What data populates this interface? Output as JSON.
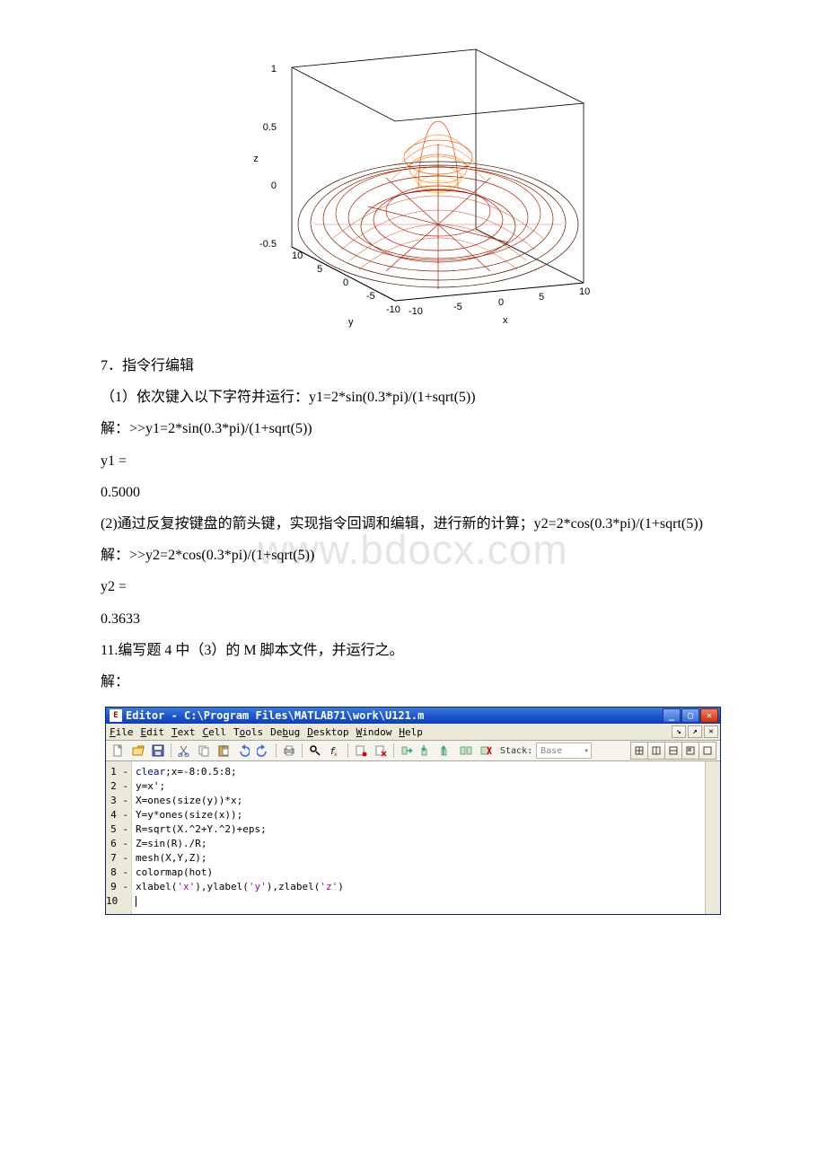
{
  "chart_data": {
    "type": "surface",
    "title": "",
    "xlabel": "x",
    "ylabel": "y",
    "zlabel": "z",
    "x_range": [
      -10,
      10
    ],
    "y_range": [
      -10,
      10
    ],
    "z_range": [
      -0.5,
      1
    ],
    "x_ticks": [
      -10,
      -5,
      0,
      5,
      10
    ],
    "y_ticks": [
      -10,
      -5,
      0,
      5,
      10
    ],
    "z_ticks": [
      -0.5,
      0,
      0.5,
      1
    ],
    "function": "z = sin(sqrt(x^2+y^2)) / sqrt(x^2+y^2)",
    "colormap": "hot"
  },
  "watermark": "www.bdocx.com",
  "text": {
    "p7": "7．指令行编辑",
    "p7a": "（1）依次键入以下字符并运行：y1=2*sin(0.3*pi)/(1+sqrt(5))",
    "p7b": "解：>>y1=2*sin(0.3*pi)/(1+sqrt(5))",
    "p7c": "y1 =",
    "p7d": "0.5000",
    "p7e": "(2)通过反复按键盘的箭头键，实现指令回调和编辑，进行新的计算；y2=2*cos(0.3*pi)/(1+sqrt(5))",
    "p7f": "解：>>y2=2*cos(0.3*pi)/(1+sqrt(5))",
    "p7g": "y2 =",
    "p7h": " 0.3633",
    "p11": "11.编写题 4 中（3）的 M 脚本文件，并运行之。",
    "p11a": "解："
  },
  "editor": {
    "title": "Editor - C:\\Program Files\\MATLAB71\\work\\U121.m",
    "menus": [
      "File",
      "Edit",
      "Text",
      "Cell",
      "Tools",
      "Debug",
      "Desktop",
      "Window",
      "Help"
    ],
    "stack_label": "Stack:",
    "stack_value": "Base",
    "lines": [
      {
        "n": "1",
        "code": "clear;x=-8:0.5:8;"
      },
      {
        "n": "2",
        "code": "y=x';"
      },
      {
        "n": "3",
        "code": "X=ones(size(y))*x;"
      },
      {
        "n": "4",
        "code": "Y=y*ones(size(x));"
      },
      {
        "n": "5",
        "code": "R=sqrt(X.^2+Y.^2)+eps;"
      },
      {
        "n": "6",
        "code": "Z=sin(R)./R;"
      },
      {
        "n": "7",
        "code": "mesh(X,Y,Z);"
      },
      {
        "n": "8",
        "code": "colormap(hot)"
      },
      {
        "n": "9",
        "code": "xlabel('x'),ylabel('y'),zlabel('z')"
      },
      {
        "n": "10",
        "code": ""
      }
    ]
  }
}
